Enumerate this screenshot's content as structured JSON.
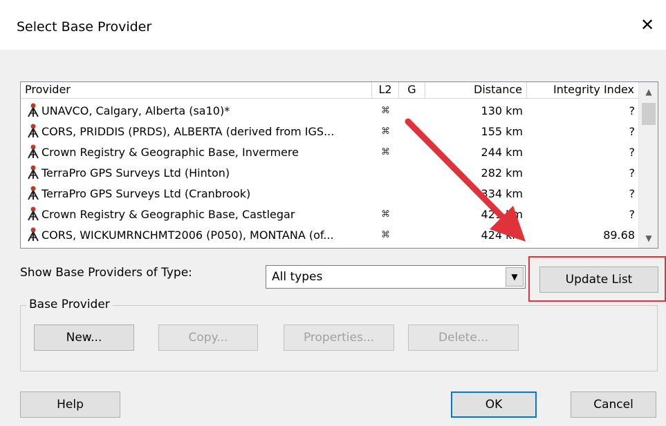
{
  "window": {
    "title": "Select Base Provider",
    "close_symbol": "✕"
  },
  "list": {
    "columns": [
      "Provider",
      "L2",
      "G",
      "Distance",
      "Integrity Index"
    ],
    "rows": [
      {
        "provider": "UNAVCO, Calgary, Alberta (sa10)*",
        "l2": "⌘",
        "g": "",
        "distance": "130 km",
        "integrity": "?"
      },
      {
        "provider": "CORS, PRIDDIS (PRDS),  ALBERTA (derived from IGS...",
        "l2": "⌘",
        "g": "",
        "distance": "155 km",
        "integrity": "?"
      },
      {
        "provider": "Crown Registry & Geographic Base, Invermere",
        "l2": "⌘",
        "g": "",
        "distance": "244 km",
        "integrity": "?"
      },
      {
        "provider": "TerraPro GPS Surveys Ltd (Hinton)",
        "l2": "",
        "g": "",
        "distance": "282 km",
        "integrity": "?"
      },
      {
        "provider": "TerraPro GPS Surveys Ltd (Cranbrook)",
        "l2": "",
        "g": "",
        "distance": "334 km",
        "integrity": "?"
      },
      {
        "provider": "Crown Registry & Geographic Base, Castlegar",
        "l2": "⌘",
        "g": "",
        "distance": "421 km",
        "integrity": "?"
      },
      {
        "provider": "CORS, WICKUMRNCHMT2006 (P050),  MONTANA (of...",
        "l2": "⌘",
        "g": "",
        "distance": "424 km",
        "integrity": "89.68"
      }
    ],
    "scroll_up": "▲",
    "scroll_down": "▼"
  },
  "filter": {
    "label": "Show Base Providers of Type:",
    "value": "All types",
    "drop_symbol": "▼",
    "update_button": "Update List"
  },
  "base_provider_group": {
    "legend": "Base Provider",
    "buttons": {
      "new": "New...",
      "copy": "Copy...",
      "properties": "Properties...",
      "delete": "Delete..."
    }
  },
  "footer": {
    "help": "Help",
    "ok": "OK",
    "cancel": "Cancel"
  },
  "colors": {
    "annotation_red": "#e0323a",
    "tripod_red": "#c0392b"
  }
}
